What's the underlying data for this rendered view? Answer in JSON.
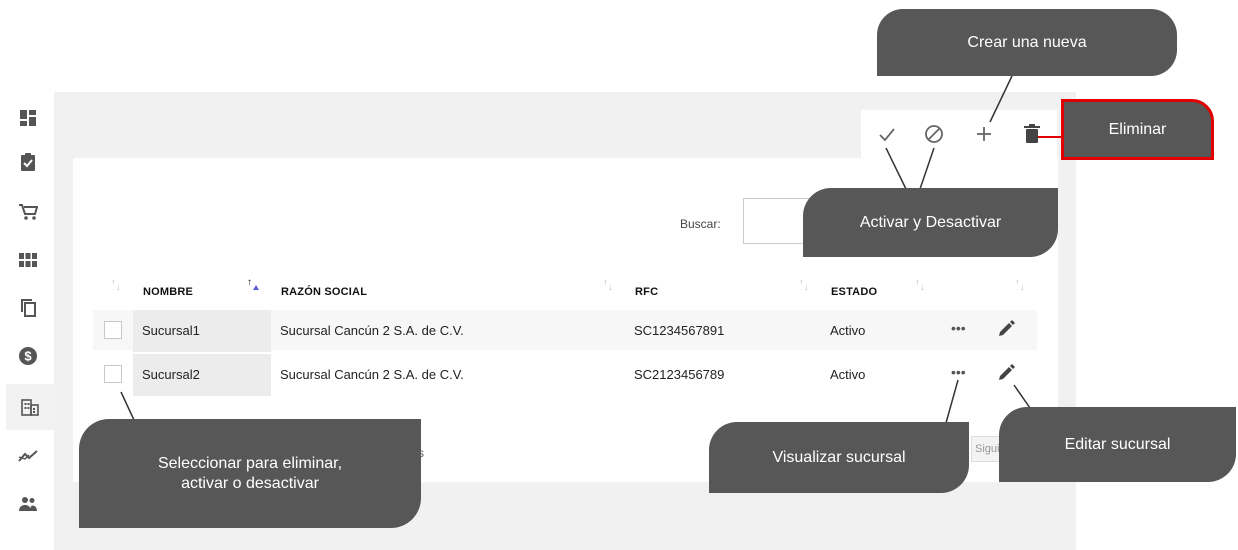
{
  "sidebar": {
    "items": [
      {
        "icon": "dashboard-icon"
      },
      {
        "icon": "clipboard-check-icon"
      },
      {
        "icon": "cart-icon"
      },
      {
        "icon": "grid-icon"
      },
      {
        "icon": "copy-icon"
      },
      {
        "icon": "dollar-icon"
      },
      {
        "icon": "building-icon",
        "active": true
      },
      {
        "icon": "trending-icon"
      },
      {
        "icon": "users-icon"
      }
    ]
  },
  "toolbar": {
    "actions": [
      "check-icon",
      "block-icon",
      "plus-icon",
      "trash-icon"
    ]
  },
  "search": {
    "label": "Buscar:",
    "value": ""
  },
  "table": {
    "columns": [
      "NOMBRE",
      "RAZÓN SOCIAL",
      "RFC",
      "ESTADO"
    ],
    "rows": [
      {
        "nombre": "Sucursal1",
        "razon_social": "Sucursal Cancún 2 S.A. de C.V.",
        "rfc": "SC1234567891",
        "estado": "Activo",
        "actions": "•••"
      },
      {
        "nombre": "Sucursal2",
        "razon_social": "Sucursal Cancún 2 S.A. de C.V.",
        "rfc": "SC2123456789",
        "estado": "Activo",
        "actions": "•••"
      }
    ]
  },
  "pagination": {
    "fragment": "s",
    "next_label": "Siguiente"
  },
  "callouts": {
    "crear": "Crear una nueva",
    "eliminar": "Eliminar",
    "activar": "Activar y Desactivar",
    "seleccionar_line1": "Seleccionar para eliminar,",
    "seleccionar_line2": "activar o desactivar",
    "visualizar": "Visualizar sucursal",
    "editar": "Editar sucursal"
  },
  "colors": {
    "callout_bg": "#575757",
    "highlight_border": "#e00000",
    "content_bg": "#f1f1f1",
    "sort_active": "#5b5bd6"
  }
}
